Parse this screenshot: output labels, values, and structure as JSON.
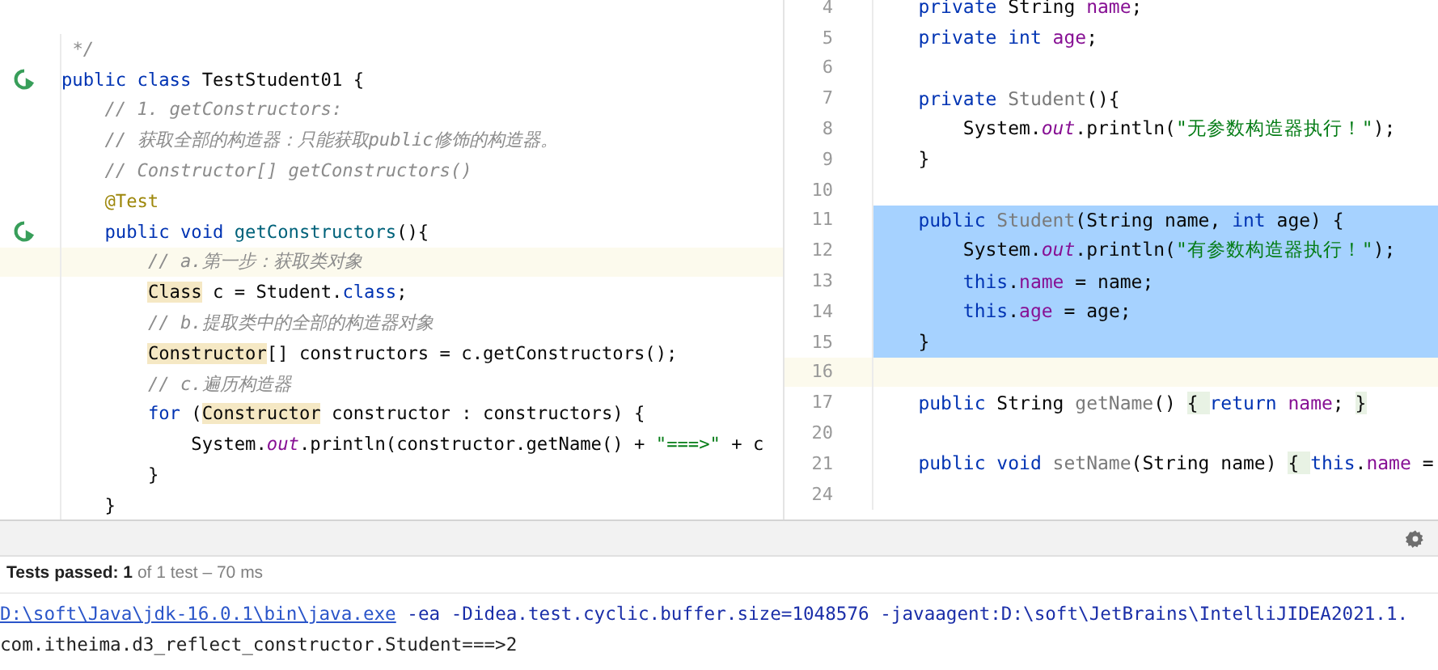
{
  "left_editor": {
    "lines": [
      {
        "run": false,
        "current": false,
        "tokens": [
          {
            "kind": "comment",
            "text": " */"
          }
        ]
      },
      {
        "run": true,
        "current": false,
        "tokens": [
          {
            "kind": "kw",
            "text": "public class "
          },
          {
            "kind": "plain",
            "text": "TestStudent01 {"
          }
        ]
      },
      {
        "run": false,
        "current": false,
        "tokens": [
          {
            "kind": "comment",
            "text": "    // 1. getConstructors:"
          }
        ]
      },
      {
        "run": false,
        "current": false,
        "tokens": [
          {
            "kind": "comment",
            "text": "    // 获取全部的构造器：只能获取public修饰的构造器。"
          }
        ]
      },
      {
        "run": false,
        "current": false,
        "tokens": [
          {
            "kind": "comment",
            "text": "    // Constructor[] getConstructors()"
          }
        ]
      },
      {
        "run": false,
        "current": false,
        "tokens": [
          {
            "kind": "annotation",
            "text": "    @Test"
          }
        ]
      },
      {
        "run": true,
        "current": false,
        "tokens": [
          {
            "kind": "kw",
            "text": "    public void "
          },
          {
            "kind": "method",
            "text": "getConstructors"
          },
          {
            "kind": "plain",
            "text": "(){"
          }
        ]
      },
      {
        "run": false,
        "current": true,
        "tokens": [
          {
            "kind": "comment",
            "text": "        // a.第一步：获取类对象"
          }
        ]
      },
      {
        "run": false,
        "current": false,
        "tokens": [
          {
            "kind": "usage",
            "text": "        Class"
          },
          {
            "kind": "plain",
            "text": " c = Student."
          },
          {
            "kind": "kw",
            "text": "class"
          },
          {
            "kind": "plain",
            "text": ";"
          }
        ]
      },
      {
        "run": false,
        "current": false,
        "tokens": [
          {
            "kind": "comment",
            "text": "        // b.提取类中的全部的构造器对象"
          }
        ]
      },
      {
        "run": false,
        "current": false,
        "tokens": [
          {
            "kind": "usage",
            "text": "        Constructor"
          },
          {
            "kind": "plain",
            "text": "[] constructors = c.getConstructors();"
          }
        ]
      },
      {
        "run": false,
        "current": false,
        "tokens": [
          {
            "kind": "comment",
            "text": "        // c.遍历构造器"
          }
        ]
      },
      {
        "run": false,
        "current": false,
        "tokens": [
          {
            "kind": "kw",
            "text": "        for "
          },
          {
            "kind": "plain",
            "text": "("
          },
          {
            "kind": "usage",
            "text": "Constructor"
          },
          {
            "kind": "plain",
            "text": " constructor : constructors) {"
          }
        ]
      },
      {
        "run": false,
        "current": false,
        "tokens": [
          {
            "kind": "plain",
            "text": "            System."
          },
          {
            "kind": "static",
            "text": "out"
          },
          {
            "kind": "plain",
            "text": ".println(constructor.getName() + "
          },
          {
            "kind": "string",
            "text": "\"===>\""
          },
          {
            "kind": "plain",
            "text": " + c"
          }
        ]
      },
      {
        "run": false,
        "current": false,
        "tokens": [
          {
            "kind": "plain",
            "text": "        }"
          }
        ]
      },
      {
        "run": false,
        "current": false,
        "tokens": [
          {
            "kind": "plain",
            "text": "    }"
          }
        ]
      }
    ]
  },
  "right_editor": {
    "lines": [
      {
        "number": "4",
        "selected": false,
        "current": false,
        "tokens": [
          {
            "kind": "kw",
            "text": "    private "
          },
          {
            "kind": "plain",
            "text": "String "
          },
          {
            "kind": "field",
            "text": "name"
          },
          {
            "kind": "plain",
            "text": ";"
          }
        ]
      },
      {
        "number": "5",
        "selected": false,
        "current": false,
        "tokens": [
          {
            "kind": "kw",
            "text": "    private int "
          },
          {
            "kind": "field",
            "text": "age"
          },
          {
            "kind": "plain",
            "text": ";"
          }
        ]
      },
      {
        "number": "6",
        "selected": false,
        "current": false
      },
      {
        "number": "7",
        "selected": false,
        "current": false,
        "tokens": [
          {
            "kind": "kw",
            "text": "    private "
          },
          {
            "kind": "unused",
            "text": "Student"
          },
          {
            "kind": "plain",
            "text": "(){"
          }
        ]
      },
      {
        "number": "8",
        "selected": false,
        "current": false,
        "tokens": [
          {
            "kind": "plain",
            "text": "        System."
          },
          {
            "kind": "static",
            "text": "out"
          },
          {
            "kind": "plain",
            "text": ".println("
          },
          {
            "kind": "string",
            "text": "\"无参数构造器执行！\""
          },
          {
            "kind": "plain",
            "text": ");"
          }
        ]
      },
      {
        "number": "9",
        "selected": false,
        "current": false,
        "tokens": [
          {
            "kind": "plain",
            "text": "    }"
          }
        ]
      },
      {
        "number": "10",
        "selected": false,
        "current": false
      },
      {
        "number": "11",
        "selected": true,
        "current": false,
        "tokens": [
          {
            "kind": "kw",
            "text": "    public "
          },
          {
            "kind": "unused",
            "text": "Student"
          },
          {
            "kind": "plain",
            "text": "(String name, "
          },
          {
            "kind": "kw",
            "text": "int "
          },
          {
            "kind": "plain",
            "text": "age) {"
          }
        ]
      },
      {
        "number": "12",
        "selected": true,
        "current": false,
        "tokens": [
          {
            "kind": "plain",
            "text": "        System."
          },
          {
            "kind": "static",
            "text": "out"
          },
          {
            "kind": "plain",
            "text": ".println("
          },
          {
            "kind": "string",
            "text": "\"有参数构造器执行！\""
          },
          {
            "kind": "plain",
            "text": ");"
          }
        ]
      },
      {
        "number": "13",
        "selected": true,
        "current": false,
        "tokens": [
          {
            "kind": "kw",
            "text": "        this"
          },
          {
            "kind": "plain",
            "text": "."
          },
          {
            "kind": "field",
            "text": "name"
          },
          {
            "kind": "plain",
            "text": " = name;"
          }
        ]
      },
      {
        "number": "14",
        "selected": true,
        "current": false,
        "tokens": [
          {
            "kind": "kw",
            "text": "        this"
          },
          {
            "kind": "plain",
            "text": "."
          },
          {
            "kind": "field",
            "text": "age"
          },
          {
            "kind": "plain",
            "text": " = age;"
          }
        ]
      },
      {
        "number": "15",
        "selected": true,
        "current": false,
        "tokens": [
          {
            "kind": "plain",
            "text": "    }"
          }
        ]
      },
      {
        "number": "16",
        "selected": false,
        "current": true
      },
      {
        "number": "17",
        "selected": false,
        "current": false,
        "tokens": [
          {
            "kind": "kw",
            "text": "    public "
          },
          {
            "kind": "plain",
            "text": "String "
          },
          {
            "kind": "unused",
            "text": "getName"
          },
          {
            "kind": "plain",
            "text": "() "
          },
          {
            "kind": "folded",
            "text": "{ "
          },
          {
            "kind": "kw",
            "text": "return "
          },
          {
            "kind": "field",
            "text": "name"
          },
          {
            "kind": "plain",
            "text": "; "
          },
          {
            "kind": "folded",
            "text": "}"
          }
        ]
      },
      {
        "number": "20",
        "selected": false,
        "current": false
      },
      {
        "number": "21",
        "selected": false,
        "current": false,
        "tokens": [
          {
            "kind": "kw",
            "text": "    public void "
          },
          {
            "kind": "unused",
            "text": "setName"
          },
          {
            "kind": "plain",
            "text": "(String name) "
          },
          {
            "kind": "folded",
            "text": "{ "
          },
          {
            "kind": "kw",
            "text": "this"
          },
          {
            "kind": "plain",
            "text": "."
          },
          {
            "kind": "field",
            "text": "name"
          },
          {
            "kind": "plain",
            "text": " ="
          }
        ]
      },
      {
        "number": "24",
        "selected": false,
        "current": false
      }
    ]
  },
  "test_status": {
    "passed": "Tests passed: 1",
    "detail": "of 1 test – 70 ms"
  },
  "console": {
    "lines": [
      [
        {
          "kind": "link",
          "text": "D:\\soft\\Java\\jdk-16.0.1\\bin\\java.exe"
        },
        {
          "kind": "command",
          "text": " -ea -Didea.test.cyclic.buffer.size=1048576 -javaagent:D:\\soft\\JetBrains\\IntelliJIDEA2021.1."
        }
      ],
      [
        {
          "kind": "output",
          "text": "com.itheima.d3_reflect_constructor.Student===>2"
        }
      ]
    ]
  }
}
